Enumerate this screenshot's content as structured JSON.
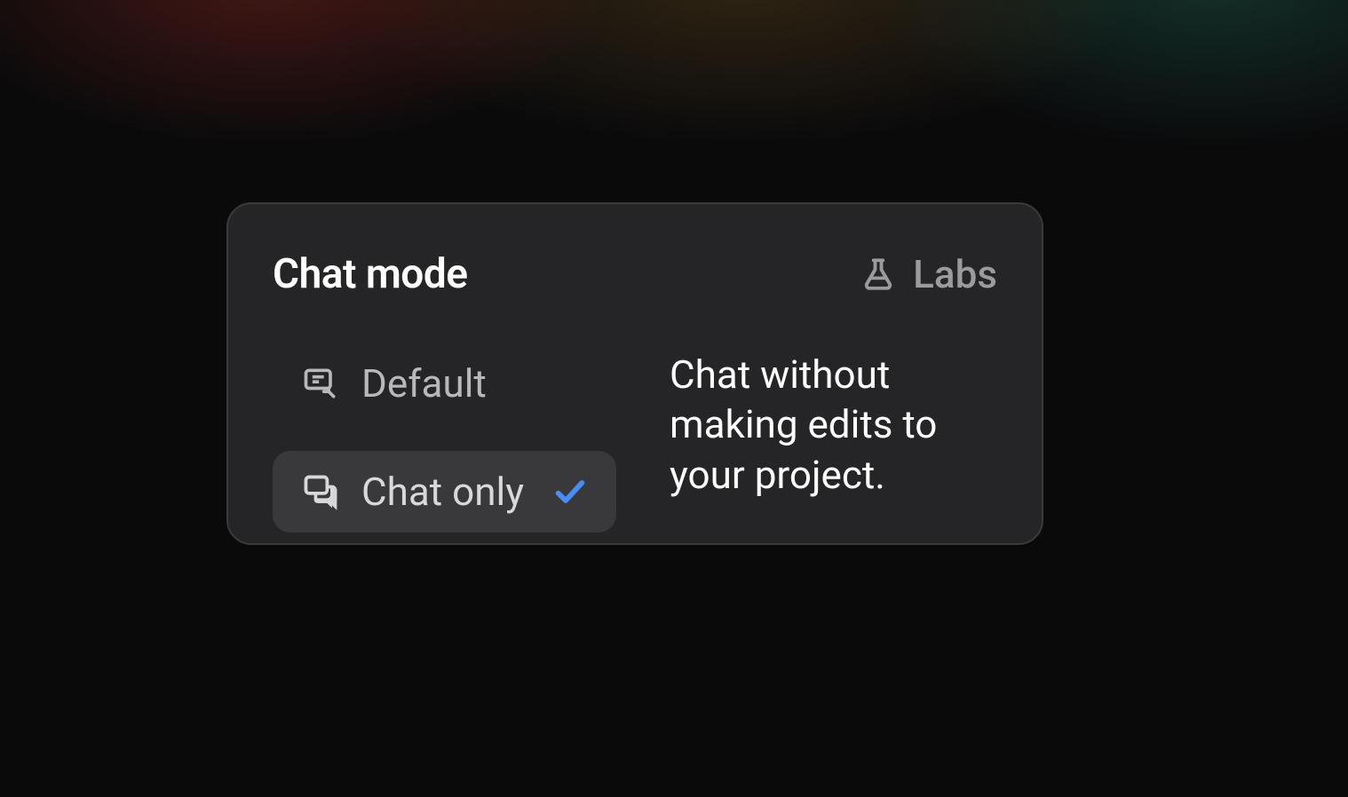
{
  "panel": {
    "title": "Chat mode",
    "labs_label": "Labs",
    "modes": [
      {
        "label": "Default",
        "selected": false
      },
      {
        "label": "Chat only",
        "selected": true
      }
    ],
    "description": "Chat without making edits to your project."
  },
  "colors": {
    "check": "#4a8cf7",
    "panel_bg": "#252527",
    "panel_border": "#3a3a3d",
    "selected_bg": "#39393c"
  }
}
